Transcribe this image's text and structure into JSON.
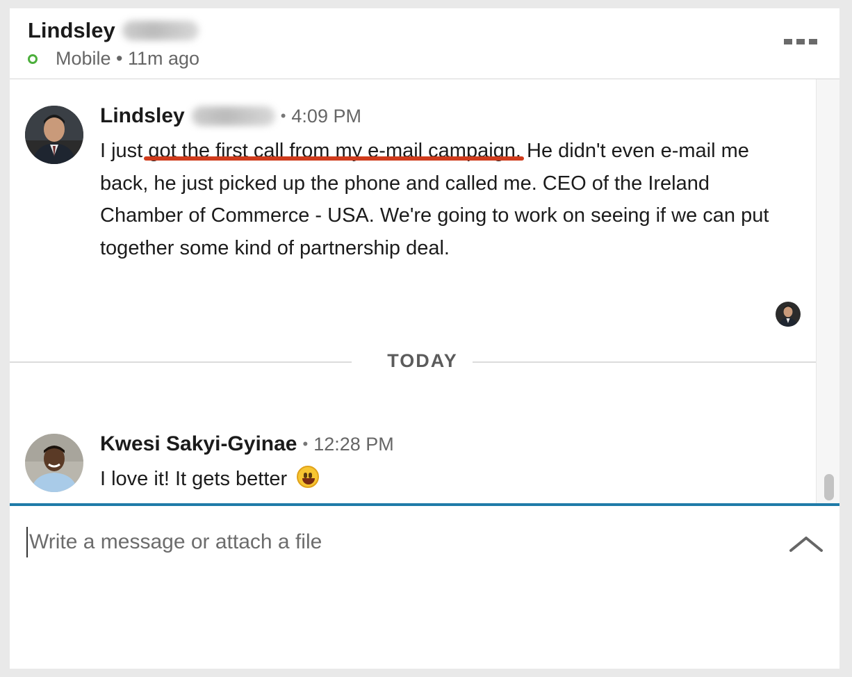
{
  "header": {
    "contact_first_name": "Lindsley",
    "presence_text": "Mobile • 11m ago",
    "presence_color": "#4caf3c"
  },
  "messages": [
    {
      "sender": "Lindsley",
      "separator": "•",
      "time": "4:09 PM",
      "text_before": "I just ",
      "text_highlight": "got the first call from my e-mail campaign.",
      "text_after": "  He didn't even e-mail me back, he just picked up the phone and called me.  CEO of the Ireland Chamber of Commerce - USA.  We're going to work on seeing if we can put together some kind of partnership deal."
    },
    {
      "sender": "Kwesi Sakyi-Gyinae",
      "separator": "•",
      "time": "12:28 PM",
      "text": "I love it! It gets better",
      "emoji": "grinning-face"
    }
  ],
  "divider": {
    "label": "TODAY"
  },
  "composer": {
    "placeholder": "Write a message or attach a file"
  },
  "colors": {
    "accent": "#1f7ba8",
    "underline_annotation": "#cf3b1c"
  }
}
